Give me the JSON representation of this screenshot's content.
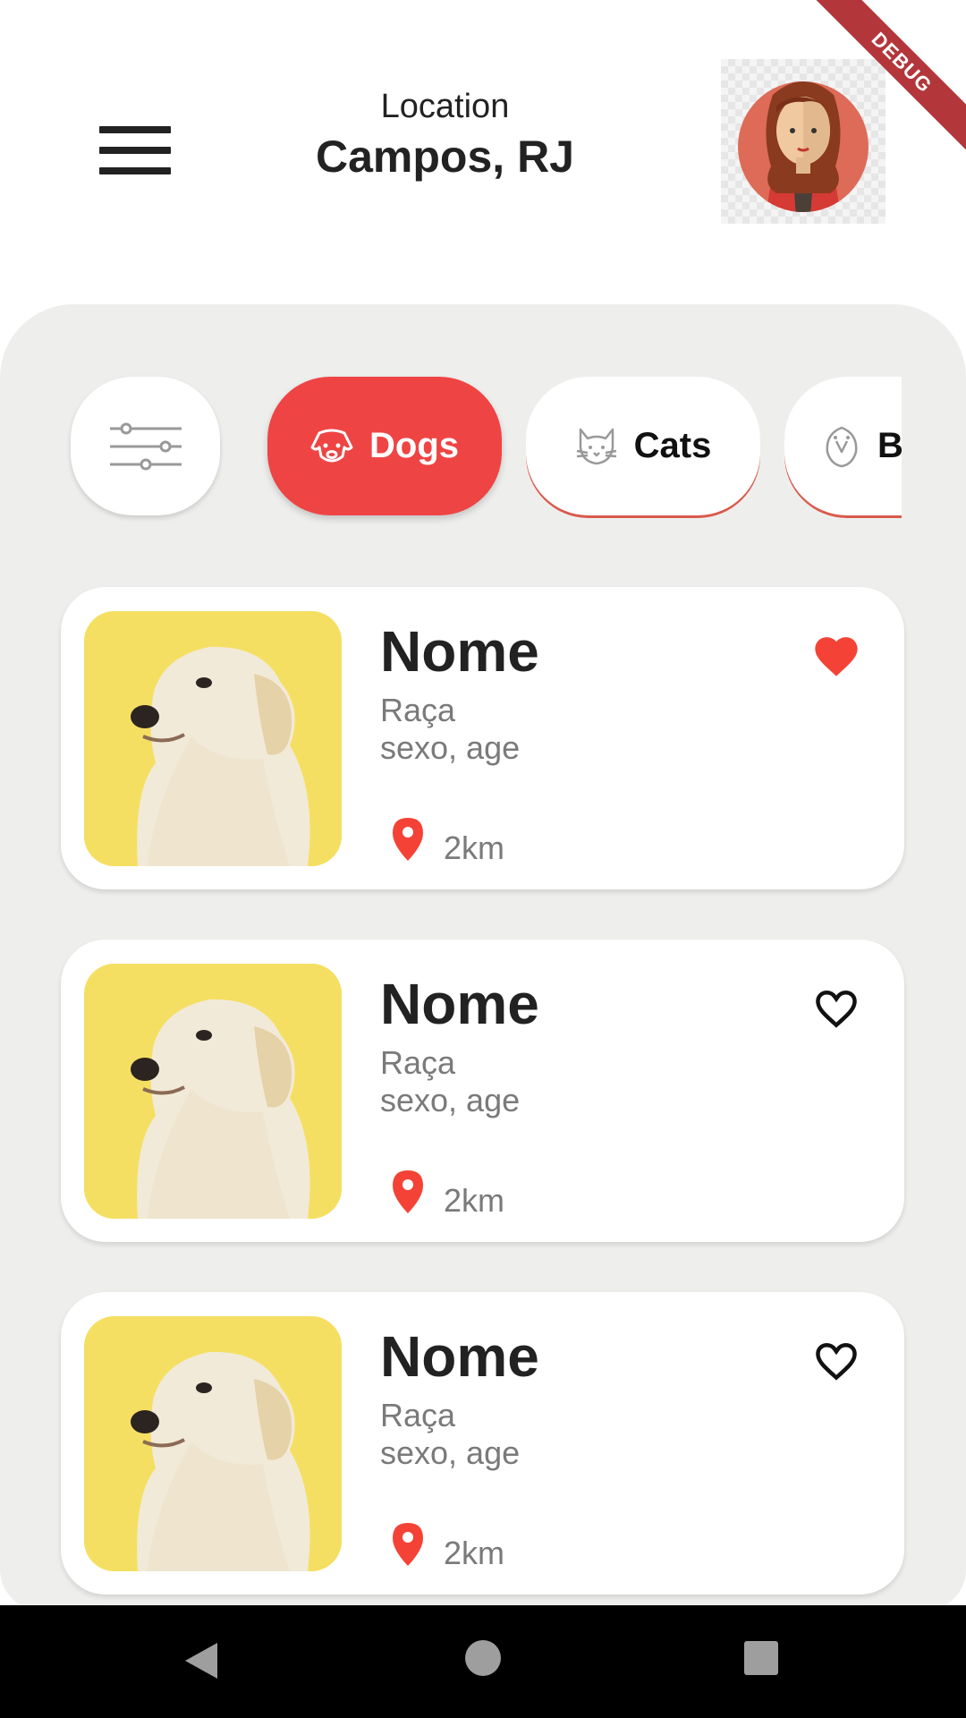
{
  "header": {
    "location_label": "Location",
    "location_value": "Campos, RJ",
    "debug_banner": "DEBUG"
  },
  "categories": [
    {
      "label": "Dogs",
      "icon": "dog-icon",
      "active": true
    },
    {
      "label": "Cats",
      "icon": "cat-icon",
      "active": false
    },
    {
      "label": "B",
      "icon": "bird-icon",
      "active": false
    }
  ],
  "pets": [
    {
      "name": "Nome",
      "breed": "Raça",
      "info": "sexo, age",
      "distance": "2km",
      "favorite": true
    },
    {
      "name": "Nome",
      "breed": "Raça",
      "info": "sexo, age",
      "distance": "2km",
      "favorite": false
    },
    {
      "name": "Nome",
      "breed": "Raça",
      "info": "sexo, age",
      "distance": "2km",
      "favorite": false
    }
  ],
  "colors": {
    "accent": "#ef4444",
    "panel": "#eeefed",
    "heart": "#f44336"
  }
}
